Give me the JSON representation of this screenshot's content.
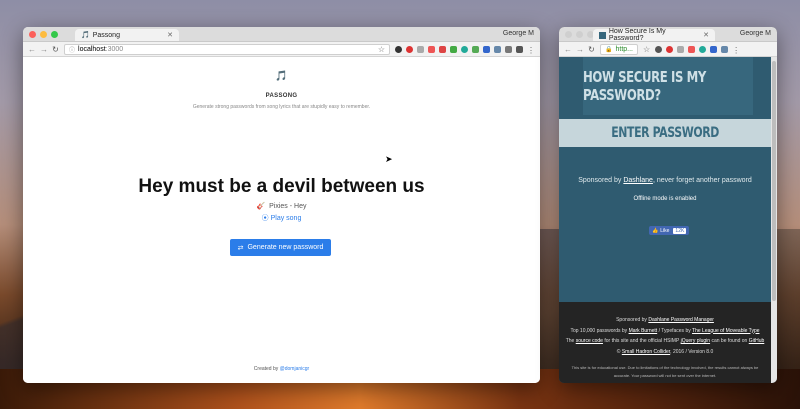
{
  "browser1": {
    "tab_title": "Passong",
    "user": "George M",
    "url_host": "localhost",
    "url_port": ":3000"
  },
  "passong": {
    "logo": "🎵",
    "brand": "PASSONG",
    "tagline": "Generate strong passwords from song lyrics that are stupidly easy to remember.",
    "password": "Hey must be a devil between us",
    "song_icon": "🎸",
    "song": "Pixies - Hey",
    "play_label": "Play song",
    "generate_label": "Generate new password",
    "credit_prefix": "Created by",
    "credit_link": "@domjanicgr"
  },
  "browser2": {
    "tab_title": "How Secure Is My Password?",
    "user": "George M",
    "url": "http..."
  },
  "hsimp": {
    "title": "HOW SECURE IS MY PASSWORD?",
    "input_placeholder": "ENTER PASSWORD",
    "sponsor_prefix": "Sponsored by",
    "sponsor_link": "Dashlane",
    "sponsor_suffix": ", never forget another password",
    "offline": "Offline mode is enabled",
    "like_label": "Like",
    "like_count": "12K",
    "footer_line1_prefix": "Sponsored by",
    "footer_line1_link": "Dashlane Password Manager",
    "footer_line2_a": "Top 10,000 passwords by",
    "footer_line2_link1": "Mark Burnett",
    "footer_line2_b": "/ Typefaces by",
    "footer_line2_link2": "The League of Moveable Type",
    "footer_line3_a": "The",
    "footer_line3_link1": "source code",
    "footer_line3_b": "for this site and the official HSIMP",
    "footer_line3_link2": "jQuery plugin",
    "footer_line3_c": "can be found on",
    "footer_line3_link3": "GitHub",
    "footer_line4_a": "©",
    "footer_line4_link": "Small Hadron Collider",
    "footer_line4_b": ", 2016 / Version 8.0",
    "legal1": "This site is for educational use. Due to limitations of the technology involved, the results cannot always be",
    "legal2": "accurate. Your password will not be sent over the internet."
  },
  "colors": {
    "primary": "#2b7de9",
    "hsimp_bg": "#2f5b70",
    "hsimp_title_bg": "#37677d",
    "hsimp_input_bg": "#c6d6db"
  }
}
